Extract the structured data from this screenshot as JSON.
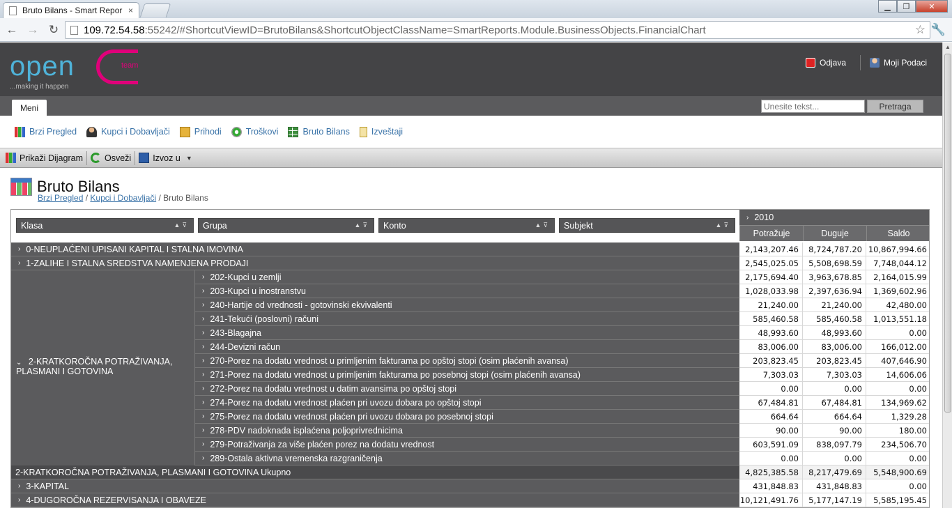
{
  "browser": {
    "tab_title": "Bruto Bilans - Smart Repor",
    "tab_close": "×",
    "url_host": "109.72.54.58",
    "url_rest": ":55242/#ShortcutViewID=BrutoBilans&ShortcutObjectClassName=SmartReports.Module.BusinessObjects.FinancialChart",
    "icons": [
      "back-icon",
      "forward-icon",
      "reload-icon",
      "bookmark-star-icon",
      "wrench-icon"
    ]
  },
  "header": {
    "logo_text": "open",
    "logo_team": "team",
    "logo_tagline": "...making it happen",
    "logout_label": "Odjava",
    "profile_label": "Moji Podaci"
  },
  "menubar": {
    "tab_label": "Meni",
    "search_placeholder": "Unesite tekst...",
    "search_button": "Pretraga"
  },
  "shortcuts": [
    {
      "label": "Brzi Pregled",
      "icon": "chart-icon"
    },
    {
      "label": "Kupci i Dobavljači",
      "icon": "person-icon"
    },
    {
      "label": "Prihodi",
      "icon": "folder-icon"
    },
    {
      "label": "Troškovi",
      "icon": "gear-icon"
    },
    {
      "label": "Bruto Bilans",
      "icon": "grid-icon"
    },
    {
      "label": "Izveštaji",
      "icon": "clipboard-icon"
    }
  ],
  "toolbar": {
    "show_chart": "Prikaži Dijagram",
    "refresh": "Osveži",
    "export": "Izvoz u"
  },
  "page": {
    "title": "Bruto Bilans",
    "breadcrumb": [
      {
        "label": "Brzi Pregled"
      },
      {
        "label": "Kupci i Dobavljači"
      },
      {
        "label": "Bruto Bilans"
      }
    ],
    "breadcrumb_sep": "/"
  },
  "grid": {
    "fields": [
      "Klasa",
      "Grupa",
      "Konto",
      "Subjekt"
    ],
    "year": "2010",
    "measures": [
      "Potražuje",
      "Duguje",
      "Saldo"
    ],
    "expanded_klasa": "2-KRATKOROČNA POTRAŽIVANJA, PLASMANI I GOTOVINA",
    "rows": [
      {
        "type": "klasa",
        "label": "0-NEUPLAĆENI UPISANI KAPITAL I STALNA IMOVINA",
        "values": [
          "2,143,207.46",
          "8,724,787.20",
          "10,867,994.66"
        ]
      },
      {
        "type": "klasa",
        "label": "1-ZALIHE I STALNA SREDSTVA NAMENJENA PRODAJI",
        "values": [
          "2,545,025.05",
          "5,508,698.59",
          "7,748,044.12"
        ]
      },
      {
        "type": "grupa",
        "label": "202-Kupci u zemlji",
        "values": [
          "2,175,694.40",
          "3,963,678.85",
          "2,164,015.99"
        ]
      },
      {
        "type": "grupa",
        "label": "203-Kupci u inostranstvu",
        "values": [
          "1,028,033.98",
          "2,397,636.94",
          "1,369,602.96"
        ]
      },
      {
        "type": "grupa",
        "label": "240-Hartije od vrednosti - gotovinski ekvivalenti",
        "values": [
          "21,240.00",
          "21,240.00",
          "42,480.00"
        ]
      },
      {
        "type": "grupa",
        "label": "241-Tekući (poslovni) računi",
        "values": [
          "585,460.58",
          "585,460.58",
          "1,013,551.18"
        ]
      },
      {
        "type": "grupa",
        "label": "243-Blagajna",
        "values": [
          "48,993.60",
          "48,993.60",
          "0.00"
        ]
      },
      {
        "type": "grupa",
        "label": "244-Devizni račun",
        "values": [
          "83,006.00",
          "83,006.00",
          "166,012.00"
        ]
      },
      {
        "type": "grupa",
        "label": "270-Porez na dodatu vrednost u primljenim fakturama po opštoj stopi (osim plaćenih avansa)",
        "values": [
          "203,823.45",
          "203,823.45",
          "407,646.90"
        ]
      },
      {
        "type": "grupa",
        "label": "271-Porez na dodatu vrednost u primljenim fakturama po posebnoj stopi (osim plaćenih avansa)",
        "values": [
          "7,303.03",
          "7,303.03",
          "14,606.06"
        ]
      },
      {
        "type": "grupa",
        "label": "272-Porez na dodatu vrednost u datim avansima po opštoj stopi",
        "values": [
          "0.00",
          "0.00",
          "0.00"
        ]
      },
      {
        "type": "grupa",
        "label": "274-Porez na dodatu vrednost plaćen pri uvozu dobara po opštoj stopi",
        "values": [
          "67,484.81",
          "67,484.81",
          "134,969.62"
        ]
      },
      {
        "type": "grupa",
        "label": "275-Porez na dodatu vrednost plaćen pri uvozu dobara po posebnoj stopi",
        "values": [
          "664.64",
          "664.64",
          "1,329.28"
        ]
      },
      {
        "type": "grupa",
        "label": "278-PDV nadoknada isplaćena poljoprivrednicima",
        "values": [
          "90.00",
          "90.00",
          "180.00"
        ]
      },
      {
        "type": "grupa",
        "label": "279-Potraživanja za više plaćen porez na dodatu vrednost",
        "values": [
          "603,591.09",
          "838,097.79",
          "234,506.70"
        ]
      },
      {
        "type": "grupa",
        "label": "289-Ostala aktivna vremenska razgraničenja",
        "values": [
          "0.00",
          "0.00",
          "0.00"
        ]
      },
      {
        "type": "total",
        "label": "2-KRATKOROČNA POTRAŽIVANJA, PLASMANI I GOTOVINA Ukupno",
        "values": [
          "4,825,385.58",
          "8,217,479.69",
          "5,548,900.69"
        ]
      },
      {
        "type": "klasa",
        "label": "3-KAPITAL",
        "values": [
          "431,848.83",
          "431,848.83",
          "0.00"
        ]
      },
      {
        "type": "klasa",
        "label": "4-DUGOROČNA REZERVISANJA I OBAVEZE",
        "values": [
          "10,121,491.76",
          "5,177,147.19",
          "5,585,195.45"
        ]
      }
    ]
  },
  "colors": {
    "header_bg": "#444446",
    "menubar_bg": "#5b5b5d",
    "grid_header_bg": "#5b5b5d",
    "link": "#3a73a8",
    "logo_blue": "#4fb3d9",
    "logo_magenta": "#e0007a"
  }
}
